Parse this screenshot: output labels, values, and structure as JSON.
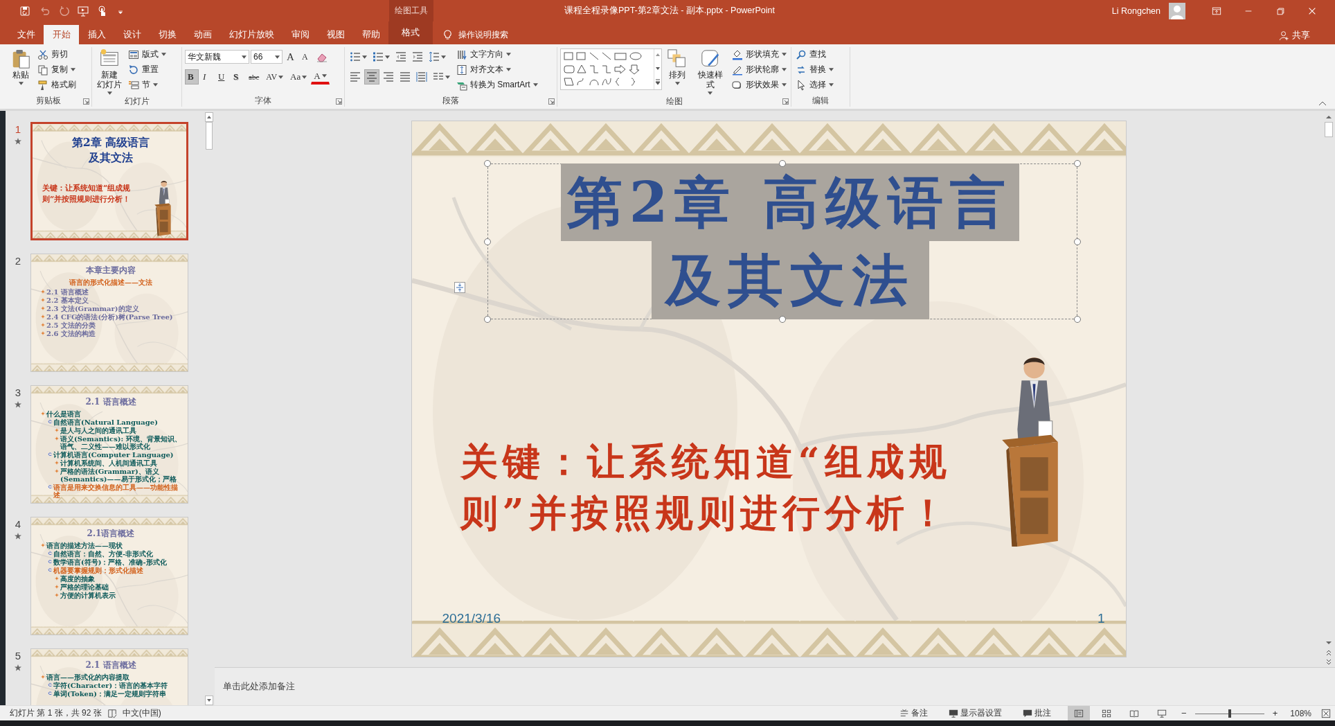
{
  "window": {
    "title": "课程全程录像PPT-第2章文法 - 副本.pptx  -  PowerPoint",
    "context_group": "绘图工具",
    "user": "Li Rongchen"
  },
  "tabs": [
    {
      "label": "文件",
      "selected": false,
      "kind": "normal"
    },
    {
      "label": "开始",
      "selected": true,
      "kind": "normal"
    },
    {
      "label": "插入",
      "selected": false,
      "kind": "normal"
    },
    {
      "label": "设计",
      "selected": false,
      "kind": "normal"
    },
    {
      "label": "切换",
      "selected": false,
      "kind": "normal"
    },
    {
      "label": "动画",
      "selected": false,
      "kind": "normal"
    },
    {
      "label": "幻灯片放映",
      "selected": false,
      "kind": "normal"
    },
    {
      "label": "审阅",
      "selected": false,
      "kind": "normal"
    },
    {
      "label": "视图",
      "selected": false,
      "kind": "normal"
    },
    {
      "label": "帮助",
      "selected": false,
      "kind": "normal"
    },
    {
      "label": "格式",
      "selected": false,
      "kind": "contextual"
    }
  ],
  "tell_me": {
    "placeholder": "操作说明搜索"
  },
  "share": "共享",
  "ribbon": {
    "groups": [
      {
        "label": "剪贴板",
        "launcher": true,
        "columns": [
          [
            {
              "kind": "large",
              "lines": [
                "粘贴"
              ],
              "dropdown": true
            }
          ],
          [
            {
              "kind": "small",
              "label": "剪切",
              "dropdown": false
            },
            {
              "kind": "small",
              "label": "复制",
              "dropdown": true
            },
            {
              "kind": "small",
              "label": "格式刷",
              "dropdown": false
            }
          ]
        ]
      },
      {
        "label": "幻灯片",
        "launcher": false,
        "columns": [
          [
            {
              "kind": "large",
              "lines": [
                "新建",
                "幻灯片"
              ],
              "dropdown": true
            }
          ],
          [
            {
              "kind": "small",
              "label": "版式",
              "dropdown": true
            },
            {
              "kind": "small",
              "label": "重置",
              "dropdown": false
            },
            {
              "kind": "small",
              "label": "节",
              "dropdown": true
            }
          ]
        ]
      },
      {
        "label": "字体",
        "launcher": true,
        "columns": [
          [
            {
              "kind": "row",
              "items": [
                {
                  "kind": "combo",
                  "value": "华文新魏"
                },
                {
                  "kind": "combo",
                  "value": "66"
                },
                {
                  "kind": "grow",
                  "label": "A",
                  "selected": false,
                  "dropdown": false
                },
                {
                  "kind": "shrink",
                  "label": "A",
                  "selected": false,
                  "dropdown": false
                },
                {
                  "kind": "tool",
                  "selected": false,
                  "dropdown": false
                }
              ]
            },
            {
              "kind": "row",
              "items": [
                {
                  "kind": "bold",
                  "label": "B",
                  "selected": true,
                  "dropdown": false
                },
                {
                  "kind": "italic",
                  "label": "I",
                  "selected": false,
                  "dropdown": false
                },
                {
                  "kind": "underline",
                  "label": "U",
                  "selected": false,
                  "dropdown": false
                },
                {
                  "kind": "shadow",
                  "label": "S",
                  "selected": false,
                  "dropdown": false
                },
                {
                  "kind": "strike",
                  "label": "abc",
                  "selected": false,
                  "dropdown": false
                },
                {
                  "kind": "spacing",
                  "label": "AV",
                  "selected": false,
                  "dropdown": true
                },
                {
                  "kind": "case",
                  "label": "Aa",
                  "selected": false,
                  "dropdown": true
                },
                {
                  "kind": "fontcolor",
                  "label": "A",
                  "selected": false,
                  "dropdown": true
                }
              ]
            }
          ]
        ]
      },
      {
        "label": "段落",
        "launcher": true,
        "columns": [
          [
            {
              "kind": "row",
              "items": [
                {
                  "kind": "tool",
                  "selected": false,
                  "dropdown": true
                },
                {
                  "kind": "tool",
                  "selected": false,
                  "dropdown": true
                },
                {
                  "kind": "tool",
                  "selected": false,
                  "dropdown": false
                },
                {
                  "kind": "tool",
                  "selected": false,
                  "dropdown": false
                },
                {
                  "kind": "tool",
                  "selected": false,
                  "dropdown": true
                }
              ]
            },
            {
              "kind": "row",
              "items": [
                {
                  "kind": "tool",
                  "selected": false,
                  "dropdown": false
                },
                {
                  "kind": "tool",
                  "selected": true,
                  "dropdown": false
                },
                {
                  "kind": "tool",
                  "selected": false,
                  "dropdown": false
                },
                {
                  "kind": "tool",
                  "selected": false,
                  "dropdown": false
                },
                {
                  "kind": "tool",
                  "selected": false,
                  "dropdown": false
                },
                {
                  "kind": "tool",
                  "selected": false,
                  "dropdown": true
                }
              ]
            }
          ],
          [
            {
              "kind": "small",
              "label": "文字方向",
              "dropdown": true
            },
            {
              "kind": "small",
              "label": "对齐文本",
              "dropdown": true
            },
            {
              "kind": "small",
              "label": "转换为 SmartArt",
              "dropdown": true
            }
          ]
        ]
      },
      {
        "label": "绘图",
        "launcher": true,
        "columns": [
          [
            {
              "kind": "gallery"
            }
          ],
          [
            {
              "kind": "large",
              "lines": [
                "排列"
              ],
              "dropdown": true
            }
          ],
          [
            {
              "kind": "large",
              "lines": [
                "快速样式"
              ],
              "dropdown": true
            }
          ],
          [
            {
              "kind": "small",
              "label": "形状填充",
              "dropdown": true
            },
            {
              "kind": "small",
              "label": "形状轮廓",
              "dropdown": true
            },
            {
              "kind": "small",
              "label": "形状效果",
              "dropdown": true
            }
          ]
        ]
      },
      {
        "label": "编辑",
        "launcher": false,
        "columns": [
          [
            {
              "kind": "small",
              "label": "查找",
              "dropdown": false
            },
            {
              "kind": "small",
              "label": "替换",
              "dropdown": true
            },
            {
              "kind": "small",
              "label": "选择",
              "dropdown": true
            }
          ]
        ]
      }
    ]
  },
  "thumbnails": [
    {
      "number": "1",
      "selected": true,
      "animated": true,
      "kind": "title",
      "lines": [
        {
          "text": "第2章 高级语言",
          "kind": "title",
          "color": "#1f3f8f"
        },
        {
          "text": "及其文法",
          "kind": "title",
          "color": "#1f3f8f"
        },
        {
          "text": "关键：让系统知道“组成规",
          "kind": "key",
          "color": "#c8361a"
        },
        {
          "text": "则”并按照规则进行分析！",
          "kind": "key",
          "color": "#c8361a"
        }
      ]
    },
    {
      "number": "2",
      "selected": false,
      "animated": false,
      "kind": "content",
      "lines": [
        {
          "text": "本章主要内容",
          "kind": "title",
          "color": "#6b6b9e"
        },
        {
          "text": "语言的形式化描述——文法",
          "kind": "heading",
          "color": "#d2601a"
        },
        {
          "text": "2.1 语言概述",
          "kind": "l1",
          "color": "#6b6b9e"
        },
        {
          "text": "2.2 基本定义",
          "kind": "l1",
          "color": "#6b6b9e"
        },
        {
          "text": "2.3 文法(Grammar)的定义",
          "kind": "l1",
          "color": "#6b6b9e"
        },
        {
          "text": "2.4 CFG的语法(分析)树(Parse Tree)",
          "kind": "l1",
          "color": "#6b6b9e"
        },
        {
          "text": "2.5 文法的分类",
          "kind": "l1",
          "color": "#6b6b9e"
        },
        {
          "text": "2.6 文法的构造",
          "kind": "l1",
          "color": "#6b6b9e"
        }
      ]
    },
    {
      "number": "3",
      "selected": false,
      "animated": true,
      "kind": "content",
      "lines": [
        {
          "text": "2.1 语言概述",
          "kind": "title",
          "color": "#6b6b9e"
        },
        {
          "text": "什么是语言",
          "kind": "l1",
          "color": "#0d5a5a"
        },
        {
          "text": "自然语言(Natural Language)",
          "kind": "l2",
          "color": "#0d5a5a"
        },
        {
          "text": "是人与人之间的通讯工具",
          "kind": "l3",
          "color": "#0d5a5a"
        },
        {
          "text": "语义(Semantics): 环境、背景知识、语气、二义性——难以形式化",
          "kind": "l3",
          "color": "#0d5a5a"
        },
        {
          "text": "计算机语言(Computer Language)",
          "kind": "l2",
          "color": "#0d5a5a"
        },
        {
          "text": "计算机系统间、人机间通讯工具",
          "kind": "l3",
          "color": "#0d5a5a"
        },
        {
          "text": "严格的语法(Grammar)、语义(Semantics)——易于形式化；严格",
          "kind": "l3",
          "color": "#0d5a5a"
        },
        {
          "text": "语言是用来交换信息的工具——功能性描述",
          "kind": "l2",
          "color": "#d2601a"
        }
      ]
    },
    {
      "number": "4",
      "selected": false,
      "animated": true,
      "kind": "content",
      "lines": [
        {
          "text": "2.1语言概述",
          "kind": "title",
          "color": "#6b6b9e"
        },
        {
          "text": "语言的描述方法——现状",
          "kind": "l1",
          "color": "#0d5a5a"
        },
        {
          "text": "自然语言：自然、方便-非形式化",
          "kind": "l2",
          "color": "#0d5a5a"
        },
        {
          "text": "数学语言(符号)：严格、准确-形式化",
          "kind": "l2",
          "color": "#0d5a5a"
        },
        {
          "text": "机器要掌握规则：形式化描述",
          "kind": "l2",
          "color": "#d2601a"
        },
        {
          "text": "高度的抽象",
          "kind": "l3",
          "color": "#0d5a5a"
        },
        {
          "text": "严格的理论基础",
          "kind": "l3",
          "color": "#0d5a5a"
        },
        {
          "text": "方便的计算机表示",
          "kind": "l3",
          "color": "#0d5a5a"
        }
      ]
    },
    {
      "number": "5",
      "selected": false,
      "animated": true,
      "kind": "content",
      "lines": [
        {
          "text": "2.1 语言概述",
          "kind": "title",
          "color": "#6b6b9e"
        },
        {
          "text": "语言——形式化的内容提取",
          "kind": "l1",
          "color": "#0d5a5a"
        },
        {
          "text": "字符(Character)：语言的基本字符",
          "kind": "l2",
          "color": "#0d5a5a"
        },
        {
          "text": "单词(Token)：满足一定规则字符串",
          "kind": "l2",
          "color": "#0d5a5a"
        }
      ]
    }
  ],
  "slide": {
    "title_lines": [
      "第2章 高级语言",
      "及其文法"
    ],
    "key_lines": [
      "关键：让系统知道“组成规",
      "则”并按照规则进行分析！"
    ],
    "date": "2021/3/16",
    "number": "1"
  },
  "notes": {
    "placeholder": "单击此处添加备注"
  },
  "status_bar": {
    "slide_info": "幻灯片 第 1 张，共 92 张",
    "language": "中文(中国)",
    "notes": "备注",
    "display": "显示器设置",
    "comments": "批注",
    "views": [
      {
        "kind": "normal",
        "selected": true
      },
      {
        "kind": "sorter",
        "selected": false
      },
      {
        "kind": "reading",
        "selected": false
      },
      {
        "kind": "show",
        "selected": false
      }
    ],
    "zoom": {
      "minus": "−",
      "plus": "+",
      "level": 0.5,
      "reading": "108%"
    }
  }
}
